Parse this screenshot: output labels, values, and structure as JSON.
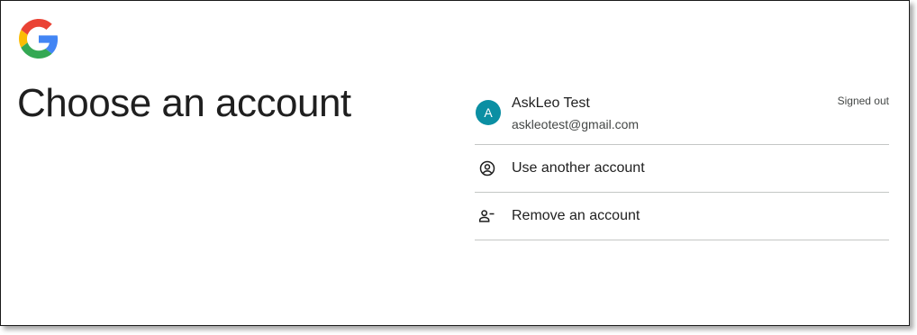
{
  "page": {
    "title": "Choose an account"
  },
  "brand": {
    "logo_icon": "google-g-logo",
    "colors": {
      "blue": "#4285F4",
      "red": "#EA4335",
      "yellow": "#FBBC05",
      "green": "#34A853"
    }
  },
  "accounts": [
    {
      "avatar_letter": "A",
      "avatar_color": "#0b8fa3",
      "name": "AskLeo Test",
      "email": "askleotest@gmail.com",
      "status": "Signed out"
    }
  ],
  "actions": {
    "use_another": {
      "label": "Use another account",
      "icon": "account-circle-icon"
    },
    "remove": {
      "label": "Remove an account",
      "icon": "person-remove-icon"
    }
  }
}
